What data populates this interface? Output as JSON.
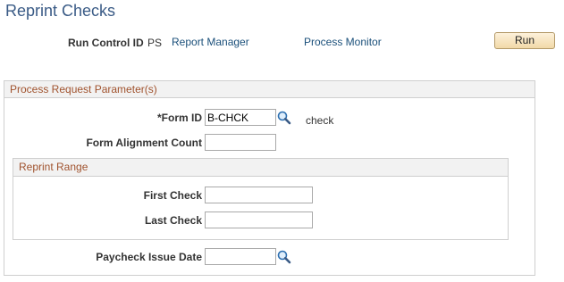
{
  "page": {
    "title": "Reprint Checks"
  },
  "run_control": {
    "label": "Run Control ID",
    "value": "PS",
    "report_manager": "Report Manager",
    "process_monitor": "Process Monitor",
    "run_button": "Run"
  },
  "params": {
    "header": "Process Request Parameter(s)",
    "form_id": {
      "label": "*Form ID",
      "value": "B-CHCK",
      "description": "check"
    },
    "form_alignment": {
      "label": "Form Alignment Count",
      "value": ""
    },
    "reprint_range": {
      "header": "Reprint Range",
      "first_check": {
        "label": "First Check",
        "value": ""
      },
      "last_check": {
        "label": "Last Check",
        "value": ""
      }
    },
    "paycheck_issue_date": {
      "label": "Paycheck Issue Date",
      "value": ""
    }
  },
  "icons": {
    "lookup": "magnifier-lookup-icon"
  },
  "colors": {
    "title": "#3a5b86",
    "group_header": "#a0522d",
    "link": "#1a4f7a",
    "button_bg": "#f1d9a7"
  }
}
